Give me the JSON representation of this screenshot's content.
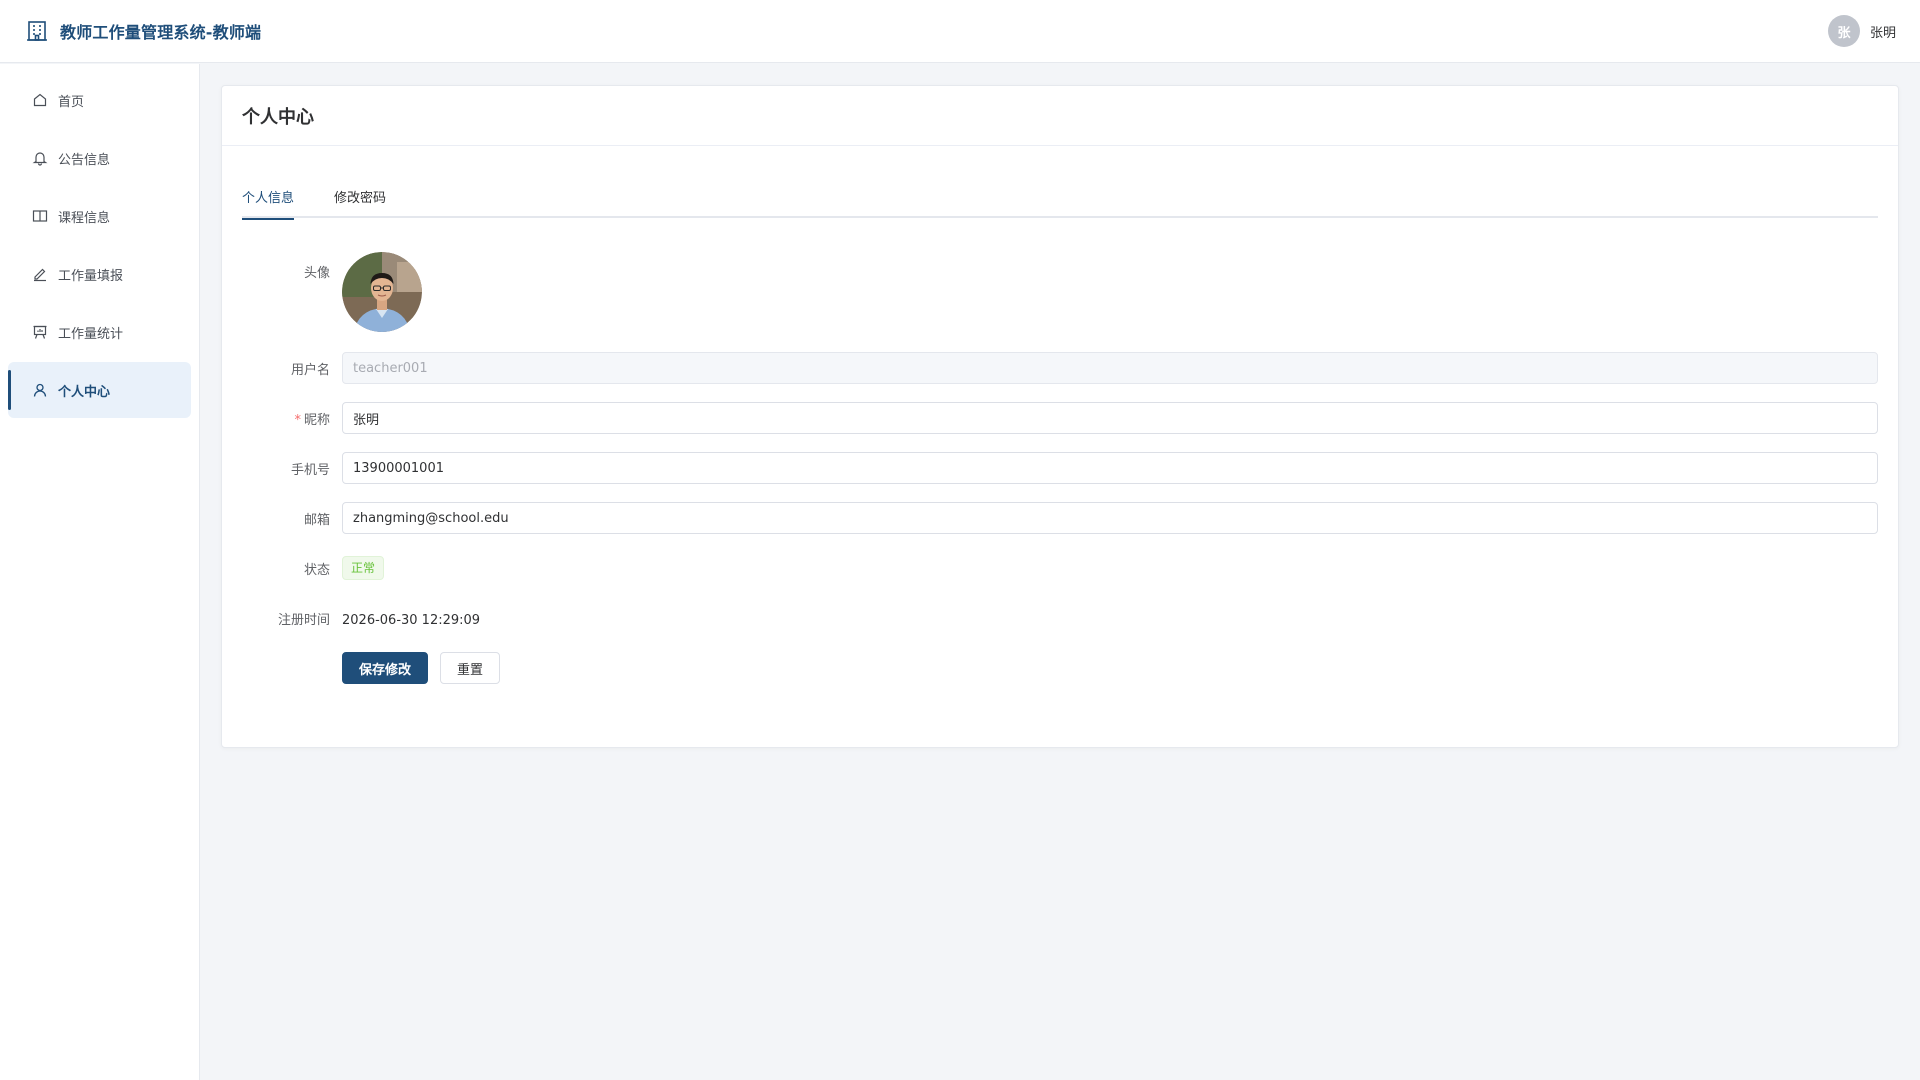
{
  "app": {
    "title": "教师工作量管理系统-教师端",
    "brand_icon": "building-icon",
    "accent_color": "#1f4e7a"
  },
  "user": {
    "avatar_char": "张",
    "name": "张明"
  },
  "sidebar": {
    "items": [
      {
        "label": "首页",
        "icon": "home-icon"
      },
      {
        "label": "公告信息",
        "icon": "bell-icon"
      },
      {
        "label": "课程信息",
        "icon": "book-icon"
      },
      {
        "label": "工作量填报",
        "icon": "pen-icon"
      },
      {
        "label": "工作量统计",
        "icon": "presentation-chart-icon"
      },
      {
        "label": "个人中心",
        "icon": "user-icon",
        "active": true
      }
    ]
  },
  "page": {
    "title": "个人中心",
    "tabs": [
      {
        "label": "个人信息",
        "active": true
      },
      {
        "label": "修改密码",
        "active": false
      }
    ]
  },
  "form": {
    "avatar_label": "头像",
    "username_label": "用户名",
    "username_value": "teacher001",
    "nickname_required_mark": "*",
    "nickname_label": "昵称",
    "nickname_value": "张明",
    "phone_label": "手机号",
    "phone_value": "13900001001",
    "email_label": "邮箱",
    "email_value": "zhangming@school.edu",
    "status_label": "状态",
    "status_value": "正常",
    "register_label": "注册时间",
    "register_value": "2026-06-30 12:29:09",
    "save_label": "保存修改",
    "reset_label": "重置"
  }
}
